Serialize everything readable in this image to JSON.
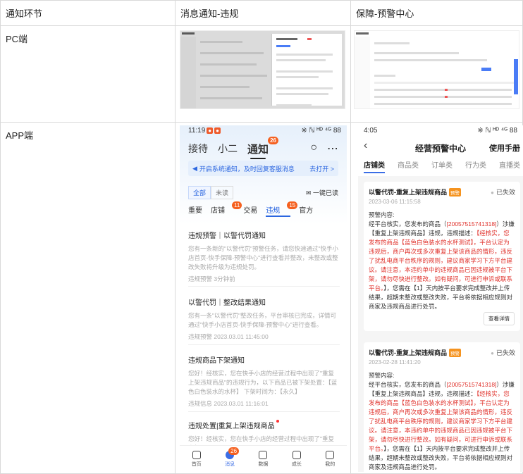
{
  "table": {
    "headers": [
      "通知环节",
      "消息通知-违规",
      "保障-预警中心"
    ],
    "row_pc": "PC端",
    "row_app": "APP端"
  },
  "phone1": {
    "status_time": "11:19",
    "status_right": "※ ℕ ᴴᴰ ⁴ᴳ 88",
    "tabs": [
      "接待",
      "小二",
      "通知"
    ],
    "notify_badge": "26",
    "notice": "开启系统通知，及时回复客服消息",
    "notice_action": "去打开 >",
    "filter_all": "全部",
    "filter_unread": "未读",
    "read_all": "一键已读",
    "cats": [
      "重要",
      "店铺",
      "交易",
      "违规",
      "官方"
    ],
    "shop_badge": "11",
    "violation_badge": "15",
    "messages": [
      {
        "title": "违规预警｜以警代罚通知",
        "body": "您有一条新的\"以警代罚\"预警任务，请您快速通过\"快手小店首页-快手保障-预警中心\"进行查看并整改，未整改或整改失败将升级为违规处罚。",
        "meta": "违规预警  3分钟前"
      },
      {
        "title": "以警代罚｜整改结果通知",
        "body": "您有一条\"以警代罚\"整改任务，平台审核已完成，详情可通过\"快手小店首页-快手保障-预警中心\"进行查看。",
        "meta": "违规预警  2023.03.01 11:45:00"
      },
      {
        "title": "违规商品下架通知",
        "body": "您好！经核实，您在快手小店的经营过程中出现了\"重复上架违规商品\"的违规行为，以下商品已被下架处置：【蓝色白色装水的水杯】 下架时间为：【永久】",
        "meta": "违规信息  2023.03.01 11:16:01"
      },
      {
        "title": "违规处置|重复上架违规商品",
        "body": "您好！经核实，您在快手小店的经营过程中出现了\"重复上架",
        "meta": ""
      }
    ],
    "tabbar": [
      "首页",
      "消息",
      "数据",
      "成长",
      "我的"
    ],
    "tabbar_badge": "26"
  },
  "phone2": {
    "status_time": "4:05",
    "status_right": "※ ℕ ᴴᴰ ⁴ᴳ 88",
    "title": "经营预警中心",
    "manual": "使用手册",
    "tabs": [
      "店铺类",
      "商品类",
      "订单类",
      "行为类",
      "直播类"
    ],
    "cards": [
      {
        "title": "以警代罚-重复上架违规商品",
        "tag": "预警",
        "status": "已失效",
        "date": "2023-03-06 11:15:58",
        "label": "预警内容:",
        "p1": "经平台核实，您发布的商品（",
        "id": "[20057515741318]",
        "p2": "）涉嫌【重复上架违规商品】违规，违规描述：",
        "red": "【经核实，您发布的商品【蓝色白色装水的水杯测试】，平台认定为违规后，商户再次或多次重复上架该商品的情形，违反了扰乱电商平台秩序的规则，建议商家学习下方平台建议。请注意，本违约单中的违规商品已因违规被平台下架，请勿尽快进行整改。如有疑问，可进行申诉或联系平台。",
        "p3": "】，您需在【1】天内按平台要求完成整改并上传结果，超期未整改或整改失败，平台将依据相应规则对商家及违规商品进行处罚。",
        "button": "查看详情"
      },
      {
        "title": "以警代罚-重复上架违规商品",
        "tag": "预警",
        "status": "已失效",
        "date": "2023-02-28 11:41:20",
        "label": "预警内容:",
        "p1": "经平台核实，您发布的商品（",
        "id": "[20057515741318]",
        "p2": "）涉嫌【重复上架违规商品】违规，违规描述：",
        "red": "【经核实，您发布的商品【蓝色白色装水的水杯测试】，平台认定为违规后，商户再次或多次重复上架该商品的情形，违反了扰乱电商平台秩序的规则，建议商家学习下方平台建议。请注意，本违约单中的违规商品已因违规被平台下架，请勿尽快进行整改。如有疑问，可进行申诉或联系平台。",
        "p3": "】，您需在【1】天内按平台要求完成整改并上传结果，超期未整改或整改失败，平台将依据相应规则对商家及违规商品进行处罚。",
        "button": ""
      }
    ]
  },
  "colors": {
    "accent": "#2b66e0",
    "badge": "#f5601f",
    "warning_red": "#e0312b",
    "tag": "#f5931f"
  }
}
